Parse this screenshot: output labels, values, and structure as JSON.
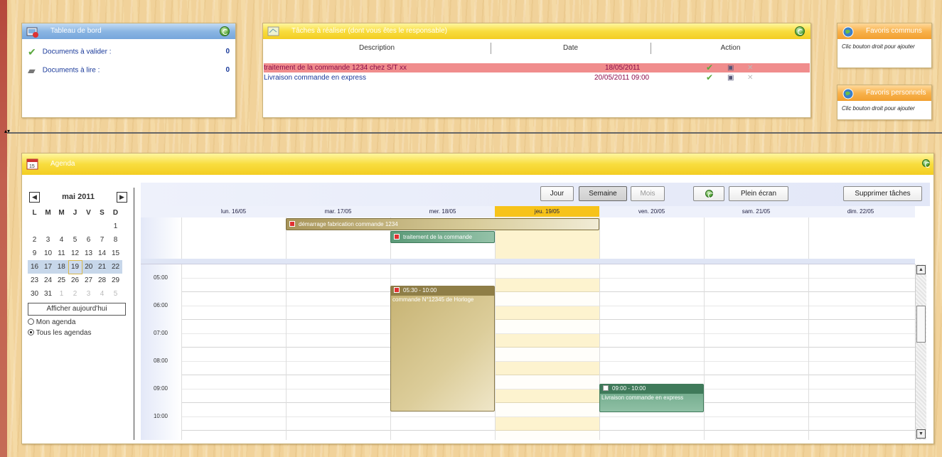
{
  "dashboard": {
    "title": "Tableau de bord",
    "items": [
      {
        "label": "Documents à valider :",
        "count": "0"
      },
      {
        "label": "Documents à lire :",
        "count": "0"
      }
    ]
  },
  "tasks": {
    "title": "Tâches à réaliser (dont vous êtes le responsable)",
    "columns": [
      "Description",
      "Date",
      "Action"
    ],
    "rows": [
      {
        "description": "traitement de la commande 1234 chez S/T xx",
        "date": "18/05/2011",
        "highlight": true
      },
      {
        "description": "Livraison commande en express",
        "date": "20/05/2011 09:00",
        "highlight": false
      }
    ]
  },
  "favoris_communs": {
    "title": "Favoris communs",
    "hint": "Clic bouton droit pour ajouter"
  },
  "favoris_perso": {
    "title": "Favoris personnels",
    "hint": "Clic bouton droit pour ajouter"
  },
  "agenda": {
    "title": "Agenda",
    "toolbar": {
      "jour": "Jour",
      "semaine": "Semaine",
      "mois": "Mois",
      "plein_ecran": "Plein écran",
      "supprimer": "Supprimer tâches"
    },
    "days": [
      "lun. 16/05",
      "mar. 17/05",
      "mer. 18/05",
      "jeu. 19/05",
      "ven. 20/05",
      "sam. 21/05",
      "dim. 22/05"
    ],
    "hours": [
      "05:00",
      "06:00",
      "07:00",
      "08:00",
      "09:00",
      "10:00"
    ],
    "allday_events": [
      {
        "label": "démarrage fabrication commande 1234"
      },
      {
        "label": "traitement de la commande"
      }
    ],
    "events": [
      {
        "time": "05:30 - 10:00",
        "label": "commande N°12345 de Horloge"
      },
      {
        "time": "09:00 - 10:00",
        "label": "Livraison commande en express"
      }
    ],
    "mini_calendar": {
      "month": "mai 2011",
      "weekdays": [
        "L",
        "M",
        "M",
        "J",
        "V",
        "S",
        "D"
      ],
      "weeks": [
        [
          "",
          "",
          "",
          "",
          "",
          "",
          "1"
        ],
        [
          "2",
          "3",
          "4",
          "5",
          "6",
          "7",
          "8"
        ],
        [
          "9",
          "10",
          "11",
          "12",
          "13",
          "14",
          "15"
        ],
        [
          "16",
          "17",
          "18",
          "19",
          "20",
          "21",
          "22"
        ],
        [
          "23",
          "24",
          "25",
          "26",
          "27",
          "28",
          "29"
        ],
        [
          "30",
          "31",
          "1",
          "2",
          "3",
          "4",
          "5"
        ]
      ],
      "today_button": "Afficher aujourd'hui"
    },
    "radio": {
      "mon_agenda": "Mon agenda",
      "tous": "Tous les agendas"
    }
  }
}
